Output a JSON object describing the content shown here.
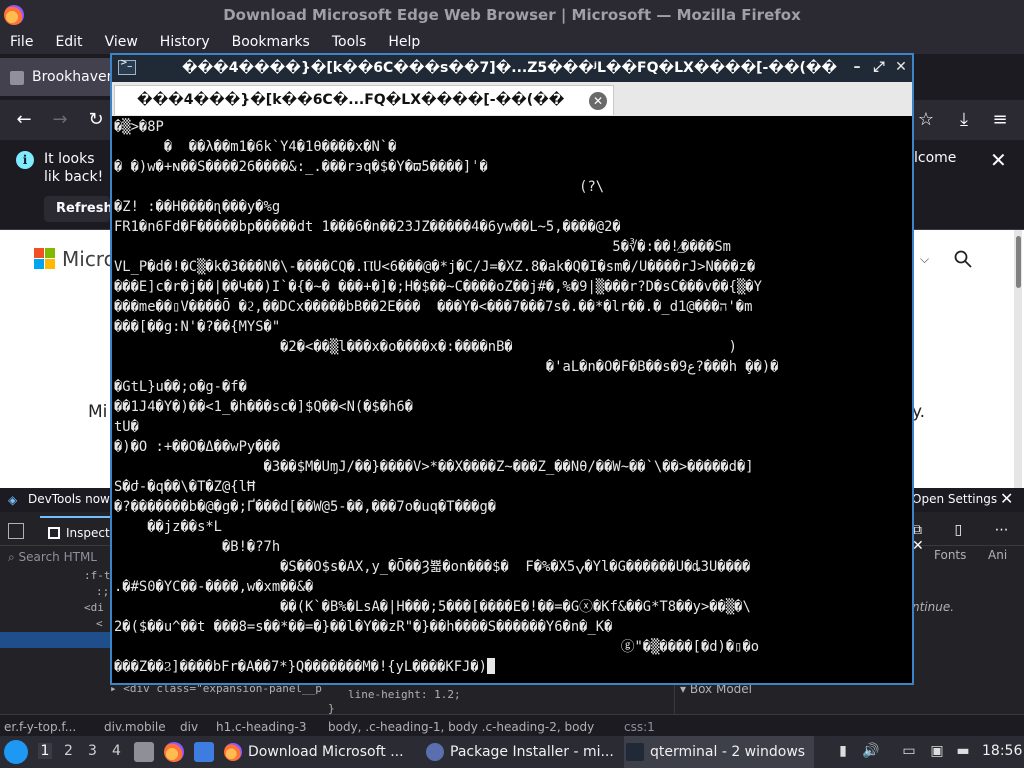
{
  "firefox": {
    "window_title": "Download Microsoft Edge Web Browser | Microsoft — Mozilla Firefox",
    "menu": [
      "File",
      "Edit",
      "View",
      "History",
      "Bookmarks",
      "Tools",
      "Help"
    ],
    "tab_label": "Brookhaven",
    "notification": {
      "text_left": "It looks lik back!",
      "text_right": "lcome",
      "refresh_label": "Refresh"
    },
    "content": {
      "brand_partial": "Micro",
      "text_left": "Mi",
      "text_right": "y."
    },
    "devtools": {
      "banner_text": "DevTools now f",
      "open_settings": "Open Settings",
      "inspector_tab": "Inspecto",
      "search_placeholder": "Search HTML",
      "tree": [
        ":f-tr",
        ":;:",
        "<di",
        "<",
        "",
        "",
        "",
        "",
        ""
      ],
      "tree_bottom": "<div class=\"expansion-panel__p",
      "css_line1": "line-height: 1.2;",
      "css_line2": "}",
      "fonts_tab": "Fonts",
      "ani_tab": "Ani",
      "continue_text": "ntinue.",
      "box_model": "Box Model",
      "breadcrumbs": [
        "er.f-y-top.f...",
        "div.mobile",
        "div",
        "h1.c-heading-3"
      ],
      "footer_rules": "body, .c-heading-1, body .c-heading-2, body",
      "footer_css": "css:1"
    }
  },
  "terminal": {
    "window_title": "���4����}�[k��6C���s��7]�...Z5���ʲL��FQ�LX����[-��(��",
    "tab_label": "���4���}�[k��6C�...FQ�LX����[-��(��",
    "lines": [
      "�▒>�8P",
      "      �  ��λ��m1�6k`Y4�1θ����x�N`�",
      "� �)w�+ɴ��S����26����&:_.���rэq�$�Y�ϖ5����]ˈ�",
      "                                                        (?\\",
      "�Z! :��H����ɳ���y�%g",
      "FR1�n6Fd�F�����bp�����dt 1���6�n��23JZ�����4�6yw��L~5,����@2�",
      "                                                            5�∛�:��!⁄̲����Sm",
      "VL_P�d�!�C▒�k�3���N�\\-����CQ�.ⲠU<6���@�*j�C/J=�XZ.8�ak�Q�I�sm�/U����rJ>N���z�",
      "���E]c�r�j��|��Կ��)I`�{�~� ���+�]�;H�$��~C����oZ��j#�,%�9|▒���r?D�sC���v��{▒�Y",
      "���me��▯V����Ō �ϩ,��DCx�����bB��2E���  ���Y�<���7���7s�.��*�lr��.�_d1@���ה'�m",
      "���[��g:N'�?��{MYS�\"",
      "                    �2�<��▒l���x�o����x�:����nB�                          )",
      "                                                    �'aL�n�O�F�B��s�9ع?���h ̧��)�",
      "�GtL}u��;o�g-�f�",
      "��1J4�Y�)��<1_�h���sc�]$Q��<N(�$�h6�",
      "tU�",
      "�)�O :+��O�Δ��wPy���",
      "                  �3��$M�UɱJ/��}����V>*��X����Z~���Z_��Nθ/��W~��`\\��>�����d�]",
      "S�ժ-�q��\\�T�Z@{lĦ",
      "�?�������b�@�g�;Ґ���d[��W@5-��,���7o�uq�T���g�",
      "    ��jz��s*L",
      "             �B!�?7h",
      "                    �S��O$s�AX,y_�Ō��Ȝ뾻�on���$�  F�%�X5ݍ�Yl�G������U�ȡ3U����",
      ".�#S0�YC��-����,w�xm��&�",
      "                    ��(K`�B%�LsA�|H���;5���[����E�!��=�Gⓧ�Kf&��G*T8��y>��▒�\\",
      "2�($��u^��t ���8=s��*��=�}��l�Y��zR\"�}��h����S������Y6�n�_K�",
      "                                                             ⓖ\"�▒����[�d)�▯�o",
      "���Z��Ϩ]����bFr�A��7*}Q�������M�!{yL����KFJ�)"
    ]
  },
  "taskbar": {
    "workspaces": [
      "1",
      "2",
      "3",
      "4"
    ],
    "tasks": [
      "Download Microsoft ...",
      "Package Installer - mi...",
      "qterminal - 2 windows"
    ],
    "clock": "18:56"
  },
  "colors": {
    "terminal_border": "#3a85c9",
    "firefox_chrome": "#2b2a33",
    "devtools_bg": "#232327",
    "taskbar_bg": "#2b2c33"
  },
  "icons": {
    "ff_logo": "firefox-logo-icon",
    "term_icon": "terminal-icon",
    "search": "search-icon",
    "close": "close-icon"
  }
}
